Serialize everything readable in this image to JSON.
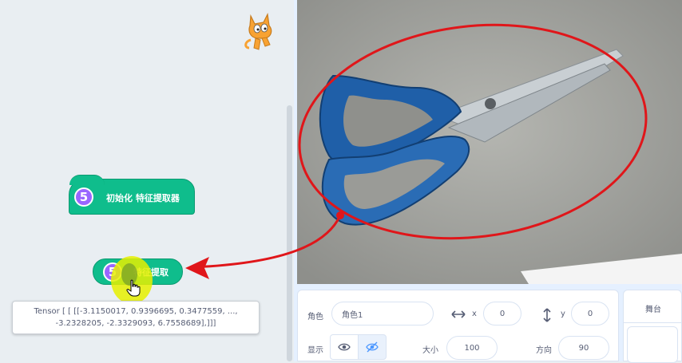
{
  "code_area": {
    "hat_block": {
      "badge": "5",
      "label": "初始化 特征提取器"
    },
    "reporter_block": {
      "badge": "5",
      "label": "特征提取"
    },
    "report_bubble": {
      "line1": "Tensor [ [ [[-3.1150017, 0.9396695, 0.3477559, ...,",
      "line2": "-3.2328205, -2.3329093, 6.7558689],]]]"
    }
  },
  "sprite_info": {
    "sprite_label": "角色",
    "sprite_name": "角色1",
    "x_label": "x",
    "x_value": "0",
    "y_label": "y",
    "y_value": "0",
    "show_label": "显示",
    "size_label": "大小",
    "size_value": "100",
    "direction_label": "方向",
    "direction_value": "90"
  },
  "stage_panel": {
    "title": "舞台"
  },
  "colors": {
    "block_green": "#0fbd8c",
    "extension_purple": "#9966ff",
    "annotation_red": "#e0161a",
    "highlight_yellow": "#e6f000"
  },
  "icons": [
    "scratch-cat-icon",
    "pointer-hand-icon",
    "arrow-horizontal-icon",
    "arrow-vertical-icon",
    "eye-icon",
    "eye-off-icon"
  ]
}
